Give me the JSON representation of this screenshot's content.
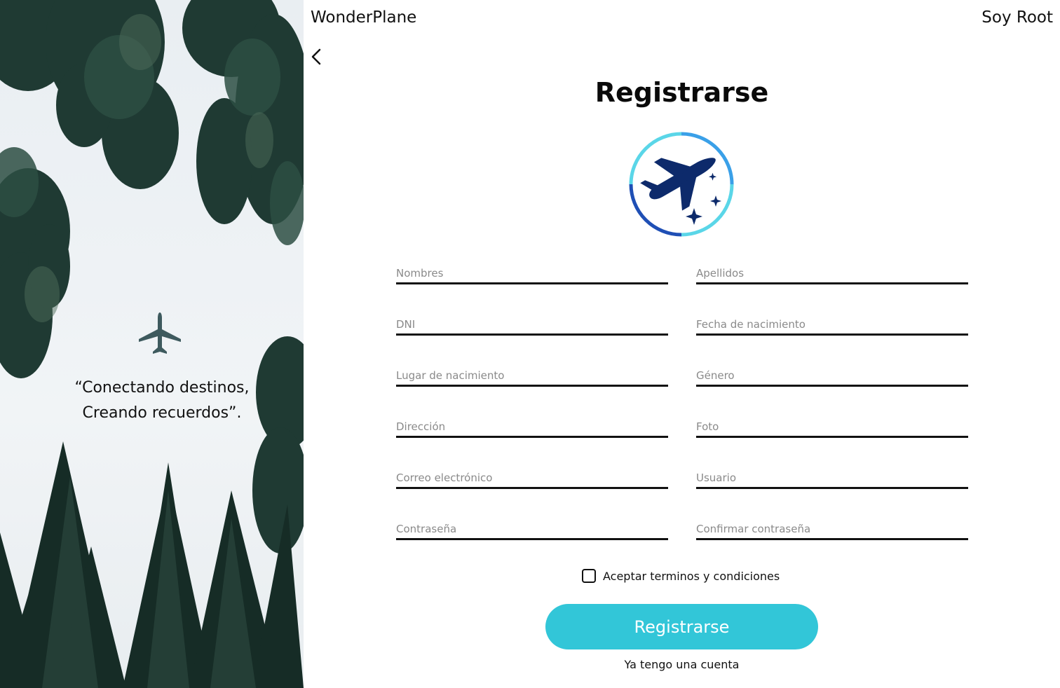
{
  "header": {
    "brand": "WonderPlane",
    "user": "Soy Root"
  },
  "hero": {
    "quote_line1": "“Conectando destinos,",
    "quote_line2": "Creando recuerdos”."
  },
  "form": {
    "title": "Registrarse",
    "fields": [
      {
        "placeholder": "Nombres",
        "value": ""
      },
      {
        "placeholder": "Apellidos",
        "value": ""
      },
      {
        "placeholder": "DNI",
        "value": ""
      },
      {
        "placeholder": "Fecha de nacimiento",
        "value": ""
      },
      {
        "placeholder": "Lugar de nacimiento",
        "value": ""
      },
      {
        "placeholder": "Género",
        "value": ""
      },
      {
        "placeholder": "Dirección",
        "value": ""
      },
      {
        "placeholder": "Foto",
        "value": ""
      },
      {
        "placeholder": "Correo electrónico",
        "value": ""
      },
      {
        "placeholder": "Usuario",
        "value": ""
      },
      {
        "placeholder": "Contraseña",
        "value": ""
      },
      {
        "placeholder": "Confirmar contraseña",
        "value": ""
      }
    ],
    "terms_label": "Aceptar terminos y condiciones",
    "terms_checked": false,
    "submit_label": "Registrarse",
    "login_link": "Ya tengo una cuenta"
  },
  "icons": {
    "back": "chevron-left-icon",
    "logo": "airplane-logo-icon",
    "hero_plane": "airplane-icon"
  },
  "colors": {
    "accent": "#32c6d8",
    "logo_navy": "#0d2a6b",
    "logo_blue": "#1f4fb5",
    "logo_cyan": "#5ad6e8",
    "text": "#111111",
    "placeholder": "#8a8a8a"
  }
}
